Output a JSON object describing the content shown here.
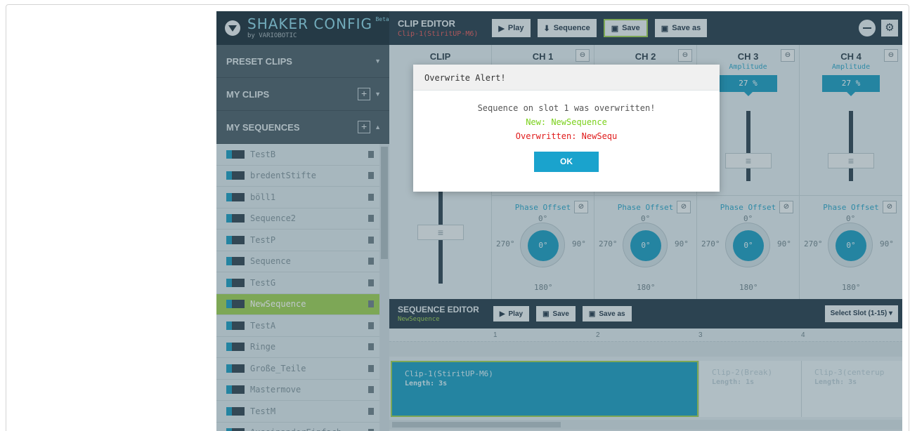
{
  "logo": {
    "title": "SHAKER CONFIG",
    "beta": "Beta",
    "subtitle": "by VARIOBOTIC"
  },
  "sidebar": {
    "preset_clips": "PRESET CLIPS",
    "my_clips": "MY CLIPS",
    "my_sequences": "MY SEQUENCES",
    "sequences": [
      "TestB",
      "bredentStifte",
      "böll1",
      "Sequence2",
      "TestP",
      "Sequence",
      "TestG",
      "NewSequence",
      "TestA",
      "Ringe",
      "Große_Teile",
      "Mastermove",
      "TestM",
      "AuseinanderEinfach"
    ],
    "selected": "NewSequence"
  },
  "clip_editor": {
    "title": "CLIP EDITOR",
    "subtitle": "Clip-1(StiritUP-M6)",
    "play": "Play",
    "sequence": "Sequence",
    "save": "Save",
    "save_as": "Save as"
  },
  "channels": {
    "clip_label": "CLIP",
    "headers": [
      "CH 1",
      "CH 2",
      "CH 3",
      "CH 4"
    ],
    "amplitude_label": "Amplitude",
    "amplitude_values": [
      "27 %",
      "27 %"
    ],
    "phase_label": "Phase Offset",
    "deg_top": "0°",
    "deg_left": "270°",
    "deg_right": "90°",
    "deg_bottom": "180°",
    "dial_value": "0°"
  },
  "sequence_editor": {
    "title": "SEQUENCE EDITOR",
    "subtitle": "NewSequence",
    "play": "Play",
    "save": "Save",
    "save_as": "Save as",
    "slot": "Select Slot (1-15)"
  },
  "timeline": {
    "ruler": [
      "1",
      "2",
      "3",
      "4"
    ],
    "clips": [
      {
        "name": "Clip-1(StiritUP-M6)",
        "length": "Length: 3s"
      },
      {
        "name": "Clip-2(Break)",
        "length": "Length: 1s"
      },
      {
        "name": "Clip-3(centerup",
        "length": "Length: 3s"
      }
    ]
  },
  "modal": {
    "title": "Overwrite Alert!",
    "message": "Sequence on slot 1 was overwritten!",
    "new_line": "New: NewSequence",
    "old_line": "Overwritten: NewSequ",
    "ok": "OK"
  },
  "colors": {
    "accent": "#1a9bc0",
    "success": "#9ccf52",
    "danger": "#e01b1b",
    "dark": "#253b4a"
  }
}
